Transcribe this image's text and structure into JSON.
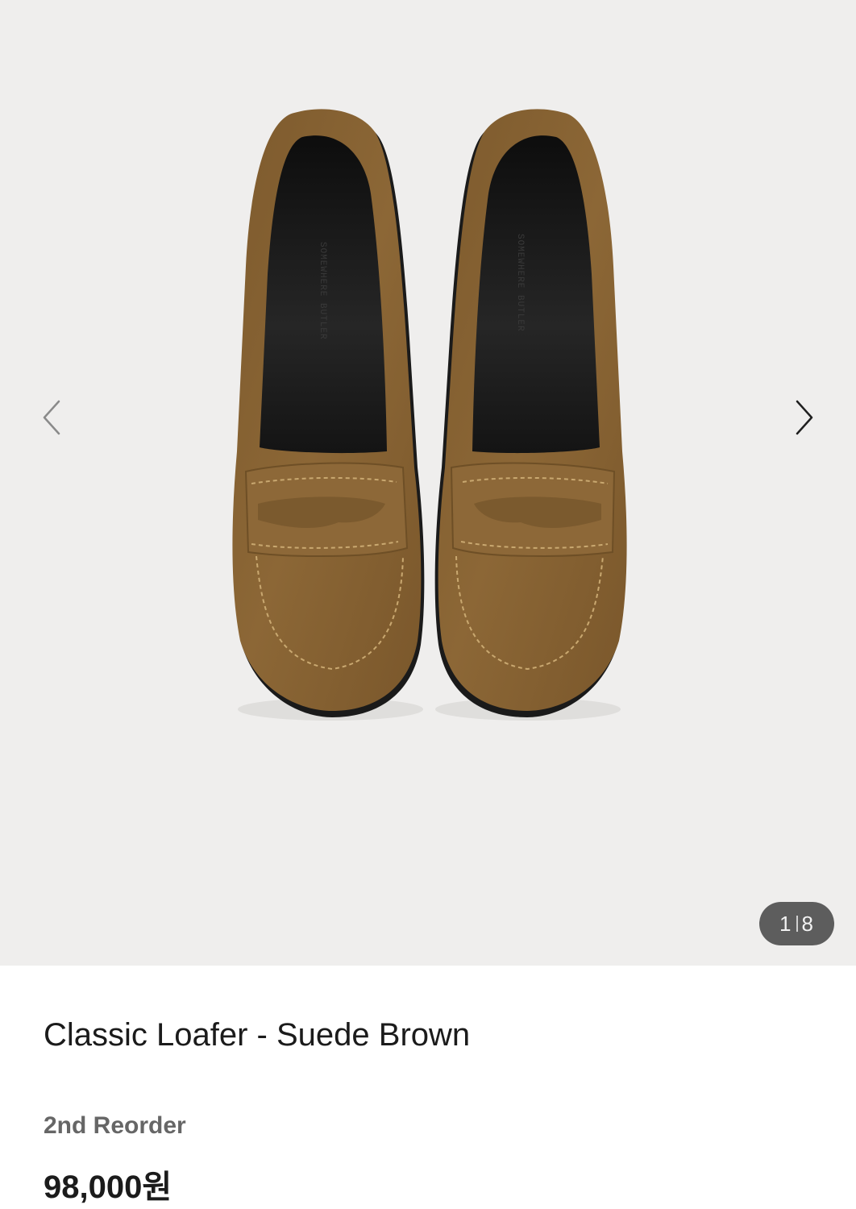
{
  "gallery": {
    "background_color": "#efeeed",
    "image_alt": "Classic Loafer - Suede Brown",
    "prev_icon": "chevron-left-icon",
    "next_icon": "chevron-right-icon",
    "current_index": "1",
    "total_count": "8",
    "suede_color": "#8a6534",
    "lining_color": "#141414"
  },
  "product": {
    "title": "Classic Loafer - Suede Brown",
    "badge": "2nd Reorder",
    "price": "98,000원"
  }
}
